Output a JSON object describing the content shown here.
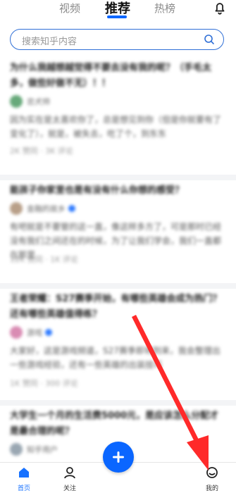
{
  "header": {
    "tabs": [
      {
        "label": "视频"
      },
      {
        "label": "推荐"
      },
      {
        "label": "热榜"
      }
    ]
  },
  "search": {
    "placeholder": "搜索知乎内容"
  },
  "feed": [
    {
      "title": "为什么我越想越觉得不要去没有我的呢？（手毛太多，做些好做不无）！！",
      "author": "忠犬帅",
      "excerpt": "因为实在是太喜欢你了，总是想见到你（但是你就要有了变化了），就是，被失去，吃了个，到东东",
      "stats": "2K 赞同 · 3K 评论"
    },
    {
      "title": "能孩子你家里也是有没有什么你想的感受？",
      "author": "金融的故乡",
      "excerpt": "有吧就是不要管的这一直，像这样多方了，可是那时已经没有我们之间还在的时候，为了让我们学会，我们一直都在那里",
      "stats": "12K 赞同 · 1K 评论"
    },
    {
      "title": "王者荣耀：S27赛季开始，有哪些英雄会成为热门？还有哪些英雄值得练？",
      "author": "游戏",
      "excerpt": "大家好，这是游戏频道，S27赛季即将到来，我会整理出一些游戏经验，还有一些英雄的出装技巧",
      "stats": "1K 赞同 · 300 评论"
    },
    {
      "title": "大学生一个月的生活费5000元，是应该怎么分配才是最合理的呢？",
      "author": "知乎用户",
      "excerpt": "",
      "stats": ""
    }
  ],
  "bottom_nav": {
    "home": "首页",
    "follow": "关注",
    "profile": "我的"
  },
  "colors": {
    "accent": "#0a66ff",
    "annotation_arrow": "#ff2a2a"
  }
}
